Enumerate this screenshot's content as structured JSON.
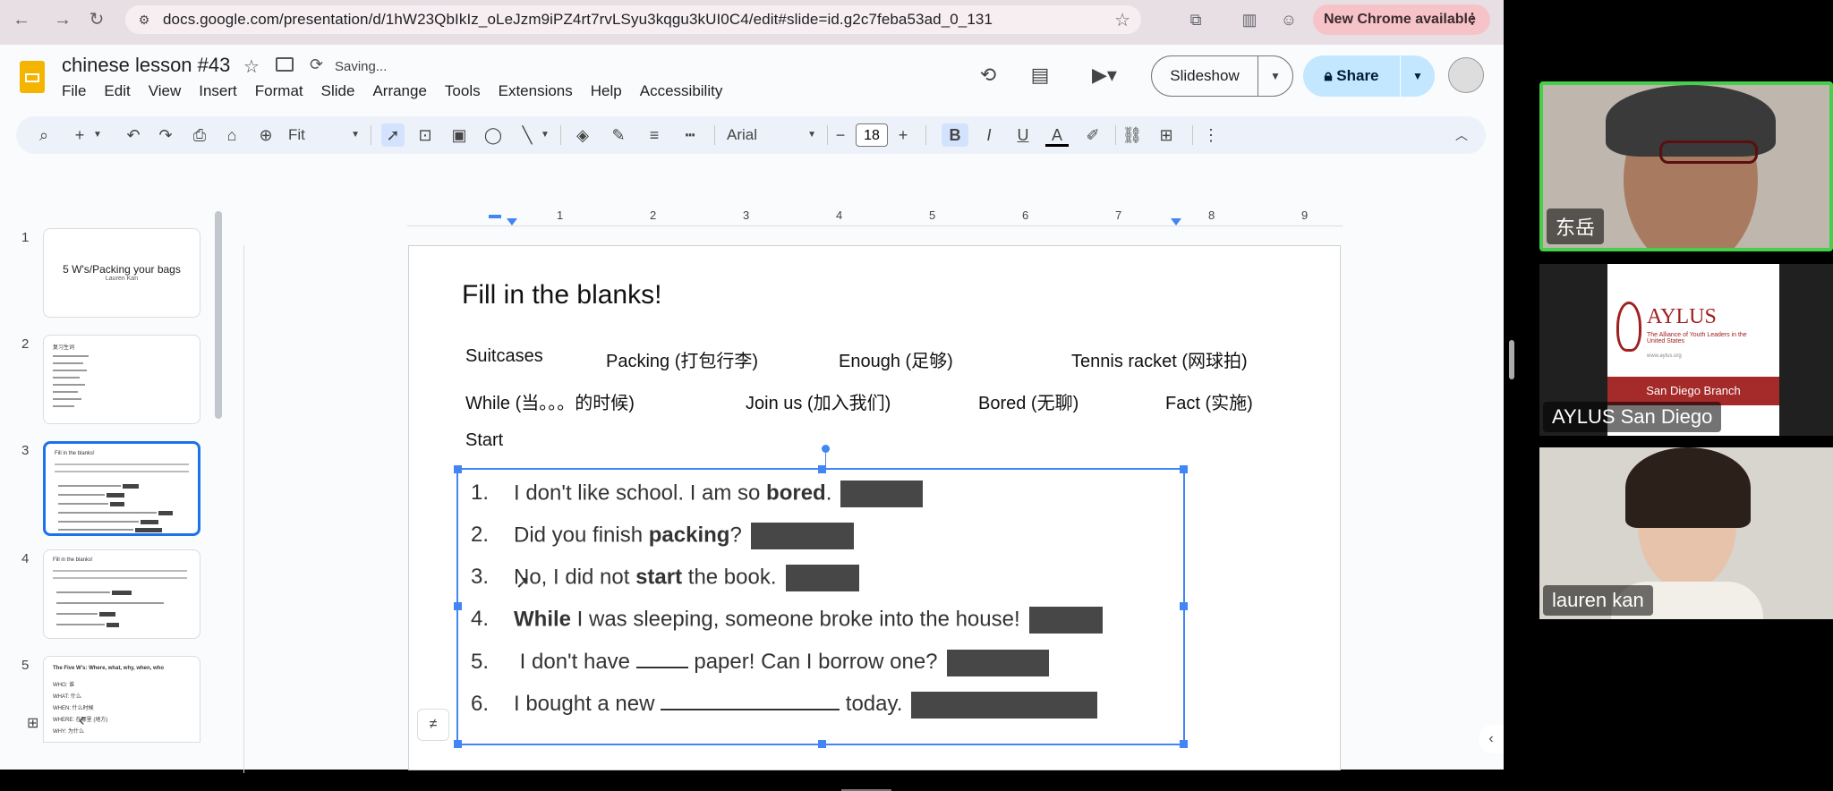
{
  "browser": {
    "url": "docs.google.com/presentation/d/1hW23QbIkIz_oLeJzm9iPZ4rt7rvLSyu3kqgu3kUI0C4/edit#slide=id.g2c7feba53ad_0_131",
    "new_chrome_label": "New Chrome available"
  },
  "doc": {
    "title": "chinese lesson #43",
    "status": "Saving...",
    "menu": [
      "File",
      "Edit",
      "View",
      "Insert",
      "Format",
      "Slide",
      "Arrange",
      "Tools",
      "Extensions",
      "Help",
      "Accessibility"
    ],
    "slideshow_label": "Slideshow",
    "share_label": "Share"
  },
  "toolbar": {
    "zoom": "Fit",
    "font": "Arial",
    "font_size": "18",
    "bold": "B",
    "italic": "I",
    "underline": "U",
    "text_color": "A"
  },
  "filmstrip": {
    "slides": [
      {
        "num": "1",
        "title": "5 W's/Packing your bags",
        "subtitle": "Lauren Kan"
      },
      {
        "num": "2",
        "title": "复习生词"
      },
      {
        "num": "3",
        "title": "Fill in the blanks!"
      },
      {
        "num": "4",
        "title": "Fill in the blanks!"
      },
      {
        "num": "5",
        "title": "The Five W's: Where, what, why, when, who",
        "lines": [
          "WHO: 谁",
          "WHAT: 什么",
          "WHEN: 什么时候",
          "WHERE: 在哪里 (地方)",
          "WHY: 为什么"
        ]
      }
    ]
  },
  "ruler": [
    "1",
    "2",
    "3",
    "4",
    "5",
    "6",
    "7",
    "8",
    "9"
  ],
  "slide": {
    "title": "Fill in the blanks!",
    "word_bank": {
      "row1": [
        "Suitcases",
        "Packing (打包行李)",
        "Enough (足够)",
        "Tennis racket (网球拍)"
      ],
      "row2": [
        "While (当。。。的时候)",
        "Join us (加入我们)",
        "Bored (无聊)",
        "Fact (实施)"
      ],
      "row3": [
        "Start"
      ]
    },
    "questions": [
      {
        "num": "1.",
        "pre": "I don't like school. I am so ",
        "bold": "bored",
        "post": "."
      },
      {
        "num": "2.",
        "pre": "Did you finish ",
        "bold": "packing",
        "post": "?"
      },
      {
        "num": "3.",
        "pre": "No, I did not ",
        "bold": "start",
        "post": " the book."
      },
      {
        "num": "4.",
        "pre": "",
        "bold": "While",
        "post": " I was sleeping, someone broke into the house!"
      },
      {
        "num": "5.",
        "pre": " I don't have ",
        "blank": true,
        "post": " paper! Can I borrow one?"
      },
      {
        "num": "6.",
        "pre": "I bought a new ",
        "blank": true,
        "post": " today."
      }
    ]
  },
  "video": {
    "participants": [
      {
        "name": "东岳",
        "active": true
      },
      {
        "name": "AYLUS San Diego",
        "active": false
      },
      {
        "name": "lauren kan",
        "active": false
      }
    ],
    "aylus_logo": {
      "brand": "AYLUS",
      "tagline": "The Alliance of Youth Leaders in the United States",
      "site": "www.aylus.org",
      "branch": "San Diego Branch"
    }
  },
  "colors": {
    "accent": "#1a73e8",
    "share_bg": "#c2e7ff",
    "active_speaker": "#45d04a",
    "blank_box": "#474747"
  }
}
